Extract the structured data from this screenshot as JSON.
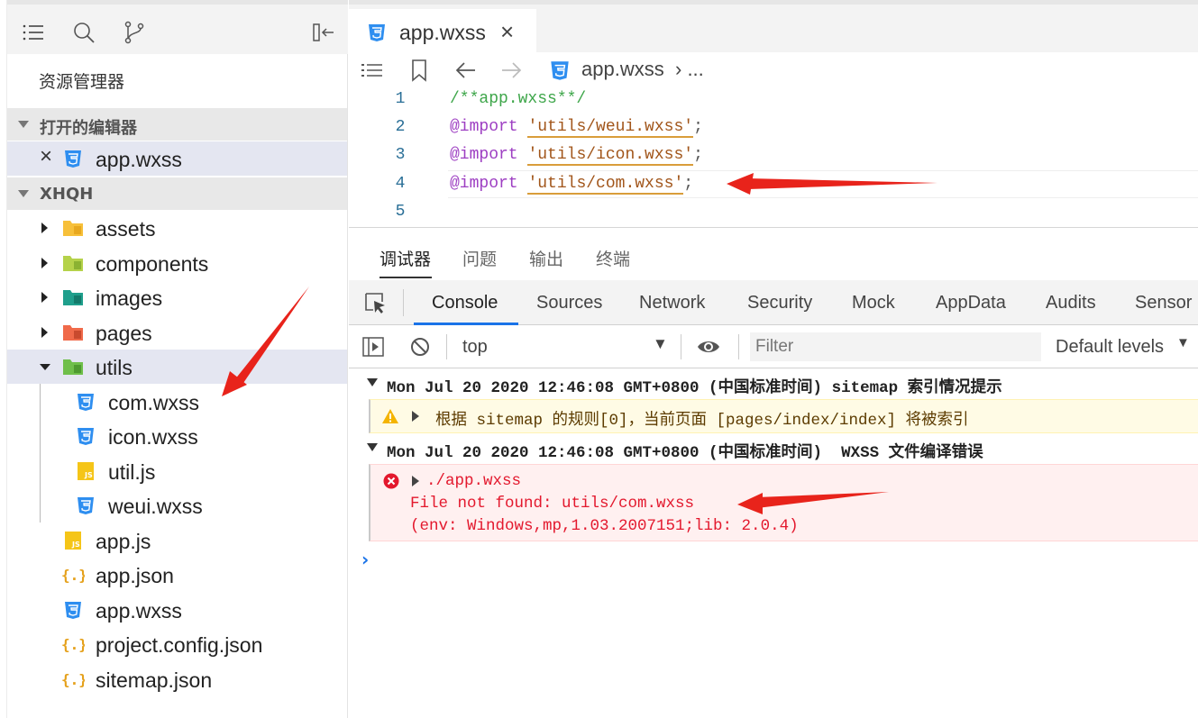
{
  "sidebar": {
    "explorer_title": "资源管理器",
    "open_editors": {
      "header": "打开的编辑器",
      "items": [
        {
          "label": "app.wxss",
          "icon": "css-icon"
        }
      ]
    },
    "project": {
      "header": "XHQH",
      "items": [
        {
          "label": "assets",
          "icon": "folder-assets-icon"
        },
        {
          "label": "components",
          "icon": "folder-components-icon"
        },
        {
          "label": "images",
          "icon": "folder-images-icon"
        },
        {
          "label": "pages",
          "icon": "folder-pages-icon"
        },
        {
          "label": "utils",
          "icon": "folder-utils-icon",
          "expanded": true,
          "children": [
            {
              "label": "com.wxss",
              "icon": "css-icon"
            },
            {
              "label": "icon.wxss",
              "icon": "css-icon"
            },
            {
              "label": "util.js",
              "icon": "js-icon"
            },
            {
              "label": "weui.wxss",
              "icon": "css-icon"
            }
          ]
        },
        {
          "label": "app.js",
          "icon": "js-icon"
        },
        {
          "label": "app.json",
          "icon": "json-icon"
        },
        {
          "label": "app.wxss",
          "icon": "css-icon"
        },
        {
          "label": "project.config.json",
          "icon": "json-icon"
        },
        {
          "label": "sitemap.json",
          "icon": "json-icon"
        }
      ]
    }
  },
  "editor": {
    "tab": {
      "label": "app.wxss"
    },
    "breadcrumb": {
      "file": "app.wxss",
      "more": "› ..."
    },
    "code": {
      "line_numbers": [
        "1",
        "2",
        "3",
        "4",
        "5"
      ],
      "comment": "/**app.wxss**/",
      "keyword": "@import",
      "imports": [
        "'utils/weui.wxss'",
        "'utils/icon.wxss'",
        "'utils/com.wxss'"
      ],
      "terminator": ";"
    }
  },
  "debug_panel": {
    "tabs": [
      "调试器",
      "问题",
      "输出",
      "终端"
    ],
    "devtools_tabs": [
      "Console",
      "Sources",
      "Network",
      "Security",
      "Mock",
      "AppData",
      "Audits",
      "Sensor"
    ],
    "console_toolbar": {
      "context": "top",
      "filter_placeholder": "Filter",
      "levels": "Default levels"
    },
    "log": {
      "group1_header": "Mon Jul 20 2020 12:46:08 GMT+0800 (中国标准时间) sitemap 索引情况提示",
      "warning": "根据 sitemap 的规则[0]，当前页面 [pages/index/index] 将被索引",
      "group2_header": "Mon Jul 20 2020 12:46:08 GMT+0800 (中国标准时间)  WXSS 文件编译错误",
      "error_source": "./app.wxss",
      "error_message": "File not found: utils/com.wxss",
      "error_env": "(env: Windows,mp,1.03.2007151;lib: 2.0.4)",
      "prompt": "›"
    }
  },
  "colors": {
    "accent": "#1a73e8",
    "error": "#e3182d",
    "annotation": "#e8231b",
    "css_icon": "#2e8ef0"
  }
}
